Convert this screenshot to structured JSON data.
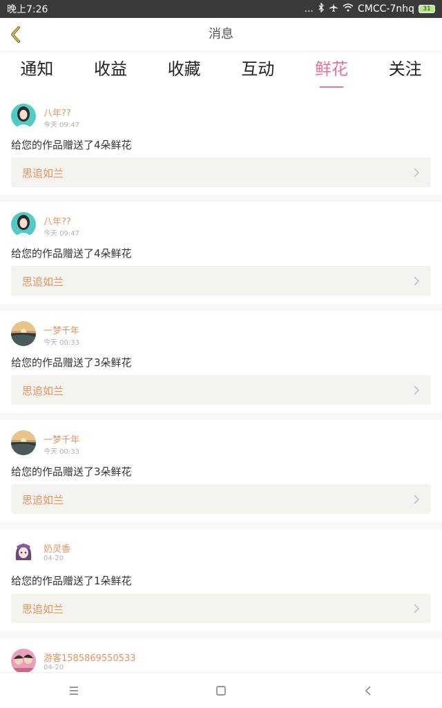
{
  "status_bar": {
    "time": "晚上7:26",
    "dots": "...",
    "carrier": "CMCC-7nhq",
    "battery": "31"
  },
  "header": {
    "title": "消息",
    "back_icon": "chevron-left-icon"
  },
  "tabs": [
    {
      "label": "通知",
      "active": false
    },
    {
      "label": "收益",
      "active": false
    },
    {
      "label": "收藏",
      "active": false
    },
    {
      "label": "互动",
      "active": false
    },
    {
      "label": "鲜花",
      "active": true
    },
    {
      "label": "关注",
      "active": false
    }
  ],
  "feed": [
    {
      "name": "八年??",
      "time": "今天 09:47",
      "message": "给您的作品赠送了4朵鲜花",
      "work": "思追如兰",
      "avatar": "girl-portrait"
    },
    {
      "name": "八年??",
      "time": "今天 09:47",
      "message": "给您的作品赠送了4朵鲜花",
      "work": "思追如兰",
      "avatar": "girl-portrait"
    },
    {
      "name": "一梦千年",
      "time": "今天 00:33",
      "message": "给您的作品赠送了3朵鲜花",
      "work": "思追如兰",
      "avatar": "sunset-landscape"
    },
    {
      "name": "一梦千年",
      "time": "今天 00:33",
      "message": "给您的作品赠送了3朵鲜花",
      "work": "思追如兰",
      "avatar": "sunset-landscape"
    },
    {
      "name": "奶灵香",
      "time": "04-20",
      "message": "给您的作品赠送了1朵鲜花",
      "work": "思追如兰",
      "avatar": "anime-girl"
    },
    {
      "name": "游客1585869550533",
      "time": "04-20",
      "avatar": "couple-photo"
    }
  ],
  "nav": {
    "menu_icon": "menu-icon",
    "home_icon": "square-home-icon",
    "back_icon": "back-arrow-icon"
  },
  "colors": {
    "accent_pink": "#e8729d",
    "name_orange": "#e8935e",
    "work_bg": "#f4f3ef"
  }
}
